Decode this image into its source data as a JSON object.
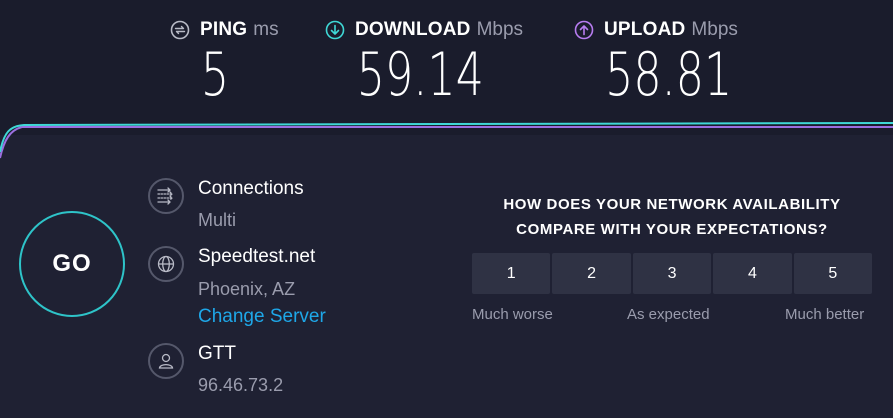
{
  "metrics": {
    "ping": {
      "label": "PING",
      "unit": "ms",
      "value": "5",
      "icon": "ping-icon",
      "color": "#b8bac6"
    },
    "download": {
      "label": "DOWNLOAD",
      "unit": "Mbps",
      "value": "59.14",
      "icon": "download-icon",
      "color": "#3fd8d6"
    },
    "upload": {
      "label": "UPLOAD",
      "unit": "Mbps",
      "value": "58.81",
      "icon": "upload-icon",
      "color": "#b77cf0"
    }
  },
  "go_button": {
    "label": "GO",
    "accent": "#2ec4c9"
  },
  "connections": {
    "title": "Connections",
    "value": "Multi",
    "icon": "connections-icon"
  },
  "server": {
    "title": "Speedtest.net",
    "location": "Phoenix, AZ",
    "change_label": "Change Server",
    "icon": "globe-icon",
    "link_color": "#1ea7e8"
  },
  "provider": {
    "title": "GTT",
    "ip": "96.46.73.2",
    "icon": "user-icon"
  },
  "survey": {
    "question_line1": "HOW DOES YOUR NETWORK AVAILABILITY",
    "question_line2": "COMPARE WITH YOUR EXPECTATIONS?",
    "ratings": [
      "1",
      "2",
      "3",
      "4",
      "5"
    ],
    "scale_low": "Much worse",
    "scale_mid": "As expected",
    "scale_high": "Much better"
  }
}
